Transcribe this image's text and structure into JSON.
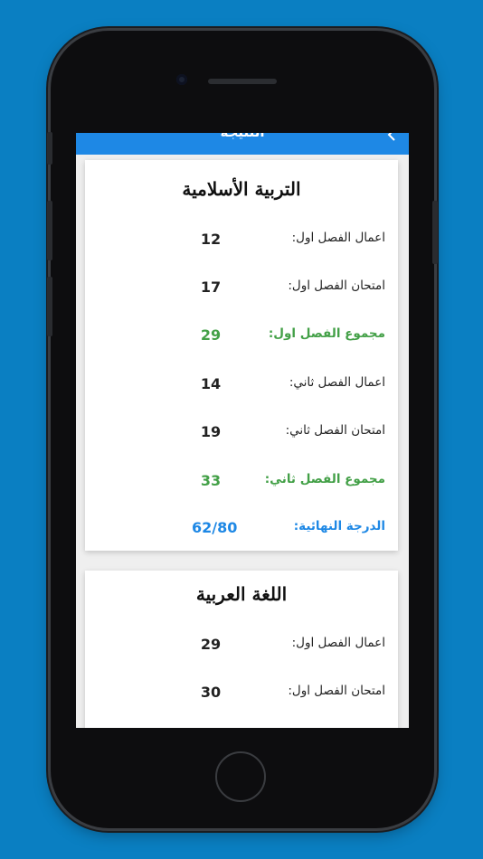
{
  "appbar": {
    "title": "النتيجة",
    "back_icon": "chevron-left-icon"
  },
  "colors": {
    "background": "#0a7fc2",
    "appbar": "#1e88e5",
    "green": "#43a047",
    "blue": "#1e88e5"
  },
  "cards": [
    {
      "title": "التربية الأسلامية",
      "rows": [
        {
          "label": "اعمال الفصل اول:",
          "value": "12"
        },
        {
          "label": "امتحان الفصل اول:",
          "value": "17"
        },
        {
          "label": "مجموع الفصل اول:",
          "value": "29"
        },
        {
          "label": "اعمال الفصل ثاني:",
          "value": "14"
        },
        {
          "label": "امتحان الفصل ثاني:",
          "value": "19"
        },
        {
          "label": "مجموع الفصل ثاني:",
          "value": "33"
        },
        {
          "label": "الدرجة النهائية:",
          "value": "62/80"
        }
      ]
    },
    {
      "title": "اللغة العربية",
      "rows": [
        {
          "label": "اعمال الفصل اول:",
          "value": "29"
        },
        {
          "label": "امتحان الفصل اول:",
          "value": "30"
        }
      ]
    }
  ]
}
